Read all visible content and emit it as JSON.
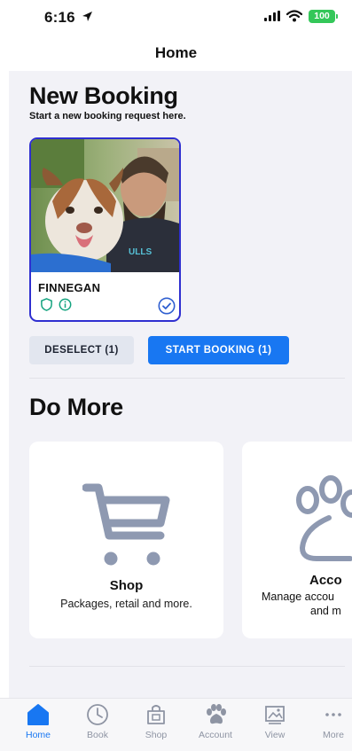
{
  "status": {
    "time": "6:16",
    "battery": "100"
  },
  "nav": {
    "title": "Home"
  },
  "booking": {
    "title": "New Booking",
    "subtitle": "Start a new booking request here.",
    "pet": {
      "name": "FINNEGAN"
    },
    "deselect_label": "DESELECT (1)",
    "start_label": "START BOOKING (1)"
  },
  "do_more": {
    "title": "Do More",
    "cards": [
      {
        "title": "Shop",
        "desc": "Packages, retail and more."
      },
      {
        "title": "Acco",
        "desc_line1": "Manage accou",
        "desc_line2": "and m"
      }
    ]
  },
  "tabs": [
    {
      "label": "Home",
      "icon": "home-icon",
      "active": true
    },
    {
      "label": "Book",
      "icon": "clock-icon"
    },
    {
      "label": "Shop",
      "icon": "shop-bag-icon"
    },
    {
      "label": "Account",
      "icon": "paw-icon"
    },
    {
      "label": "View",
      "icon": "image-icon"
    },
    {
      "label": "More",
      "icon": "more-dots-icon"
    }
  ],
  "colors": {
    "accent": "#1877f2",
    "card_border": "#2f2fd0",
    "icon_gray": "#8e99b1",
    "battery": "#34c759"
  }
}
